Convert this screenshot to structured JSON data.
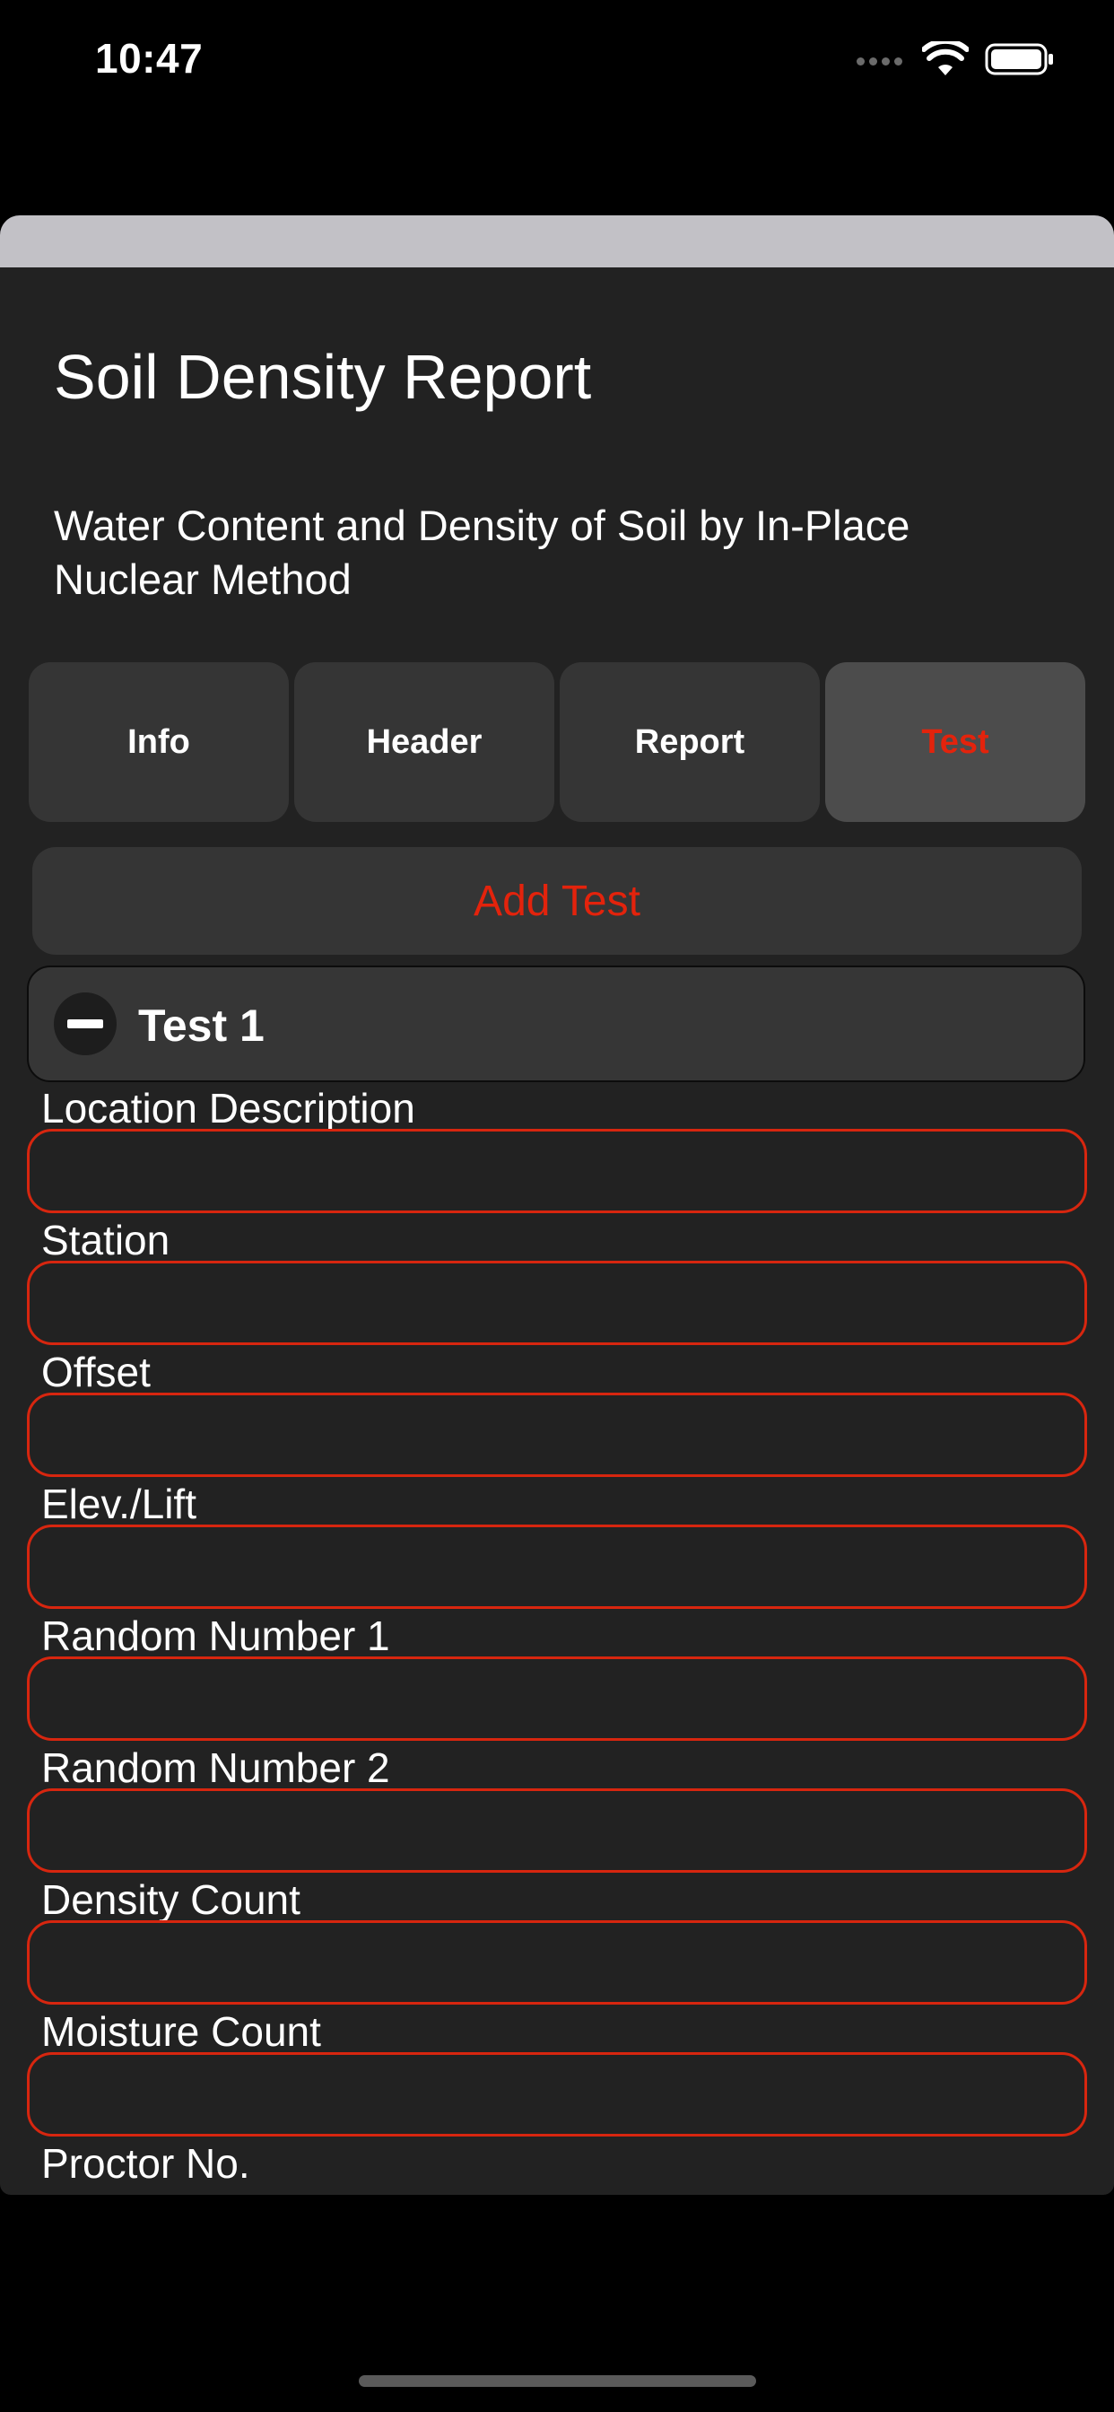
{
  "status_bar": {
    "time": "10:47"
  },
  "page": {
    "title": "Soil Density Report",
    "subtitle": "Water Content and Density of Soil by In-Place Nuclear Method"
  },
  "tabs": [
    {
      "label": "Info"
    },
    {
      "label": "Header"
    },
    {
      "label": "Report"
    },
    {
      "label": "Test"
    }
  ],
  "active_tab": "Test",
  "add_test_label": "Add Test",
  "test": {
    "title": "Test 1",
    "fields": [
      {
        "label": "Location Description",
        "value": ""
      },
      {
        "label": "Station",
        "value": ""
      },
      {
        "label": "Offset",
        "value": ""
      },
      {
        "label": "Elev./Lift",
        "value": ""
      },
      {
        "label": "Random Number 1",
        "value": ""
      },
      {
        "label": "Random Number 2",
        "value": ""
      },
      {
        "label": "Density Count",
        "value": ""
      },
      {
        "label": "Moisture Count",
        "value": ""
      },
      {
        "label": "Proctor No.",
        "value": ""
      }
    ]
  },
  "colors": {
    "accent": "#e3230c",
    "sheet_background": "#222222",
    "tab_background": "#353535",
    "active_tab_background": "#4c4c4c",
    "field_border": "#d7260f"
  }
}
